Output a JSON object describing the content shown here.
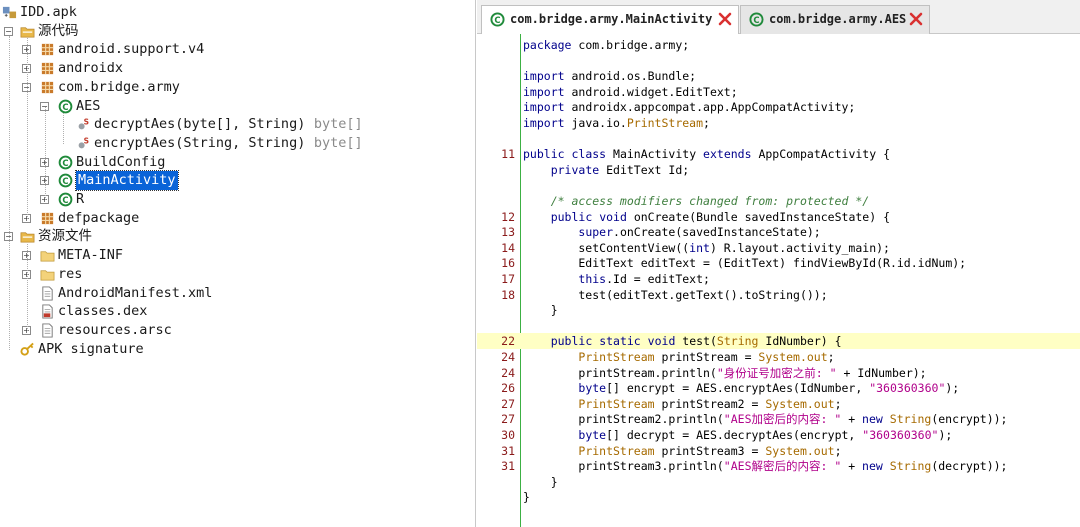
{
  "tree": {
    "rows": [
      {
        "label": "IDD.apk",
        "icon": "apk-icon",
        "level": 0
      },
      {
        "label": "源代码",
        "icon": "source-folder-icon",
        "level": 0
      },
      {
        "label": "android.support.v4",
        "icon": "package-icon",
        "level": 1
      },
      {
        "label": "androidx",
        "icon": "package-icon",
        "level": 1
      },
      {
        "label": "com.bridge.army",
        "icon": "package-icon",
        "level": 1
      },
      {
        "label": "AES",
        "icon": "class-icon",
        "level": 2
      },
      {
        "label": "decryptAes(byte[], String)",
        "type": "byte[]",
        "icon": "static-method-icon",
        "level": 3
      },
      {
        "label": "encryptAes(String, String)",
        "type": "byte[]",
        "icon": "static-method-icon",
        "level": 3
      },
      {
        "label": "BuildConfig",
        "icon": "class-icon",
        "level": 2
      },
      {
        "label": "MainActivity",
        "icon": "class-icon",
        "level": 2,
        "selected": true
      },
      {
        "label": "R",
        "icon": "class-icon",
        "level": 2
      },
      {
        "label": "defpackage",
        "icon": "package-icon",
        "level": 1
      },
      {
        "label": "资源文件",
        "icon": "resource-folder-icon",
        "level": 0
      },
      {
        "label": "META-INF",
        "icon": "folder-icon",
        "level": 1
      },
      {
        "label": "res",
        "icon": "folder-icon",
        "level": 1
      },
      {
        "label": "AndroidManifest.xml",
        "icon": "file-icon",
        "level": 1
      },
      {
        "label": "classes.dex",
        "icon": "dex-file-icon",
        "level": 1
      },
      {
        "label": "resources.arsc",
        "icon": "file-icon",
        "level": 1
      },
      {
        "label": "APK signature",
        "icon": "key-icon",
        "level": 0
      }
    ]
  },
  "tabs": [
    {
      "label": "com.bridge.army.MainActivity",
      "active": true
    },
    {
      "label": "com.bridge.army.AES",
      "active": false
    }
  ],
  "code": {
    "lines": [
      {
        "num": "",
        "text": "package com.bridge.army;"
      },
      {
        "num": "",
        "text": ""
      },
      {
        "num": "",
        "text": "import android.os.Bundle;"
      },
      {
        "num": "",
        "text": "import android.widget.EditText;"
      },
      {
        "num": "",
        "text": "import androidx.appcompat.app.AppCompatActivity;"
      },
      {
        "num": "",
        "text": "import java.io.PrintStream;"
      },
      {
        "num": "",
        "text": ""
      },
      {
        "num": "11",
        "text": "public class MainActivity extends AppCompatActivity {"
      },
      {
        "num": "",
        "text": "    private EditText Id;"
      },
      {
        "num": "",
        "text": ""
      },
      {
        "num": "",
        "text": "    /* access modifiers changed from: protected */"
      },
      {
        "num": "12",
        "text": "    public void onCreate(Bundle savedInstanceState) {"
      },
      {
        "num": "13",
        "text": "        super.onCreate(savedInstanceState);"
      },
      {
        "num": "14",
        "text": "        setContentView((int) R.layout.activity_main);"
      },
      {
        "num": "16",
        "text": "        EditText editText = (EditText) findViewById(R.id.idNum);"
      },
      {
        "num": "17",
        "text": "        this.Id = editText;"
      },
      {
        "num": "18",
        "text": "        test(editText.getText().toString());"
      },
      {
        "num": "",
        "text": "    }"
      },
      {
        "num": "",
        "text": ""
      },
      {
        "num": "22",
        "text": "    public static void test(String IdNumber) {"
      },
      {
        "num": "24",
        "text": "        PrintStream printStream = System.out;"
      },
      {
        "num": "24",
        "text": "        printStream.println(\"身份证号加密之前: \" + IdNumber);"
      },
      {
        "num": "26",
        "text": "        byte[] encrypt = AES.encryptAes(IdNumber, \"360360360\");"
      },
      {
        "num": "27",
        "text": "        PrintStream printStream2 = System.out;"
      },
      {
        "num": "27",
        "text": "        printStream2.println(\"AES加密后的内容: \" + new String(encrypt));"
      },
      {
        "num": "30",
        "text": "        byte[] decrypt = AES.decryptAes(encrypt, \"360360360\");"
      },
      {
        "num": "31",
        "text": "        PrintStream printStream3 = System.out;"
      },
      {
        "num": "31",
        "text": "        printStream3.println(\"AES解密后的内容: \" + new String(decrypt));"
      },
      {
        "num": "",
        "text": "    }"
      },
      {
        "num": "",
        "text": "}"
      }
    ]
  },
  "colors": {
    "selection": "#0a64d8",
    "keyword": "#00008b",
    "type": "#a66a00",
    "string": "#b0008a",
    "comment": "#3f7f3f",
    "gutter": "#3cb043",
    "highlight_line": "#ffffc4",
    "close_x": "#d93030"
  }
}
